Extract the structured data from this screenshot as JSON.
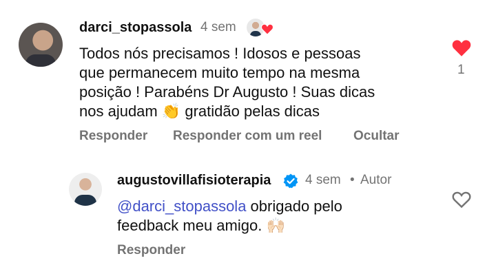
{
  "comment": {
    "username": "darci_stopassola",
    "time": "4 sem",
    "lines": [
      "Todos nós precisamos ! Idosos e pessoas",
      "que permanecem muito tempo na mesma",
      "posição ! Parabéns Dr Augusto ! Suas dicas",
      "nos ajudam 👏 gratidão pelas dicas"
    ],
    "like_count": "1",
    "actions": {
      "reply": "Responder",
      "reply_reel": "Responder com um reel",
      "hide": "Ocultar"
    }
  },
  "reply": {
    "username": "augustovillafisioterapia",
    "time": "4 sem",
    "separator": "•",
    "author_label": "Autor",
    "mention": "@darci_stopassola",
    "line1_rest": " obrigado pelo",
    "line2": "feedback meu amigo. 🙌🏻",
    "actions": {
      "reply": "Responder"
    }
  },
  "colors": {
    "like_red": "#ff3040",
    "mention_blue": "#4150c7",
    "verified_blue": "#0095f6",
    "meta_gray": "#737373"
  }
}
